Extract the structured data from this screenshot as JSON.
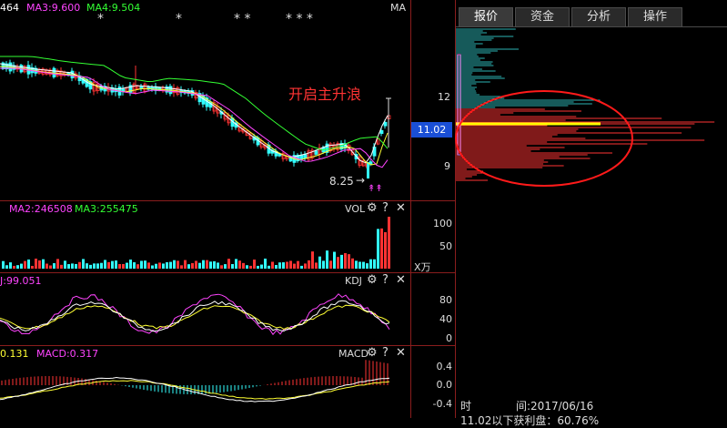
{
  "main_panel": {
    "indicators": [
      {
        "label": "464",
        "color": "#ffffff"
      },
      {
        "label": "MA3:9.600",
        "color": "#ff44ff"
      },
      {
        "label": "MA4:9.504",
        "color": "#33ff33"
      }
    ],
    "markers": [
      "*",
      "*",
      "* *",
      "* * *"
    ],
    "ma_label": "MA",
    "annotation": "开启主升浪",
    "low_label": "8.25",
    "axis_ticks": [
      "12",
      "9"
    ],
    "current_price": "11.02"
  },
  "vol_panel": {
    "indicators": [
      {
        "label": "MA2:246508",
        "color": "#ff44ff"
      },
      {
        "label": "MA3:255475",
        "color": "#33ff33"
      }
    ],
    "name": "VOL",
    "axis_ticks": [
      "100",
      "50"
    ],
    "unit": "X万"
  },
  "kdj_panel": {
    "indicators": [
      {
        "label": "J:99.051",
        "color": "#ff44ff"
      }
    ],
    "name": "KDJ",
    "axis_ticks": [
      "80",
      "40",
      "0"
    ]
  },
  "macd_panel": {
    "indicators": [
      {
        "label": "0.131",
        "color": "#ffff33"
      },
      {
        "label": "MACD:0.317",
        "color": "#ff44ff"
      }
    ],
    "name": "MACD",
    "axis_ticks": [
      "0.4",
      "0.0",
      "-0.4"
    ]
  },
  "panel_controls": {
    "settings": "⚙",
    "help": "?",
    "close": "✕"
  },
  "side_panel": {
    "tabs": [
      "报价",
      "资金",
      "分析",
      "操作"
    ],
    "time_label": "时",
    "date_label": "间:2017/06/16",
    "cutoff_text": "11.02以下获利盘：60.76%"
  },
  "colors": {
    "up": "#ff3333",
    "down": "#33ffff",
    "grid": "#8a1d1d",
    "highlight": "#ffff00",
    "price_box": "#1a4fd6"
  }
}
